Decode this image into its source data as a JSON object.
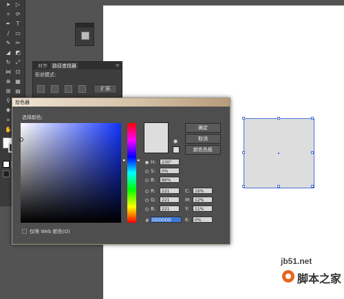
{
  "pathfinder": {
    "tabs": [
      "对齐",
      "路径查找器"
    ],
    "shape_modes_label": "形状模式:",
    "expand_label": "扩展"
  },
  "picker": {
    "title": "拾色器",
    "select_color_label": "选择颜色:",
    "ok_label": "确定",
    "cancel_label": "取消",
    "swatches_label": "颜色色板",
    "web_only_label": "仅限 Web 颜色(O)",
    "hsb": [
      {
        "key": "H",
        "label": "H:",
        "value": "230°"
      },
      {
        "key": "S",
        "label": "S:",
        "value": "0%"
      },
      {
        "key": "B",
        "label": "B:",
        "value": "86%"
      }
    ],
    "rgb": [
      {
        "key": "R",
        "label": "R:",
        "value": "221"
      },
      {
        "key": "G",
        "label": "G:",
        "value": "221"
      },
      {
        "key": "B",
        "label": "B:",
        "value": "221"
      }
    ],
    "cmyk": [
      {
        "key": "C",
        "label": "C:",
        "value": "16%"
      },
      {
        "key": "M",
        "label": "M:",
        "value": "12%"
      },
      {
        "key": "Y",
        "label": "Y:",
        "value": "11%"
      },
      {
        "key": "K",
        "label": "K:",
        "value": "0%"
      }
    ],
    "hex_label": "#",
    "hex_value": "DDDDDD",
    "current_color": "#dddddd"
  },
  "watermark": {
    "site": "jb51.net",
    "brand": "脚本之家"
  },
  "colors": {
    "selection_blue": "#4a6fd8",
    "fill_gray": "#dddddd"
  }
}
